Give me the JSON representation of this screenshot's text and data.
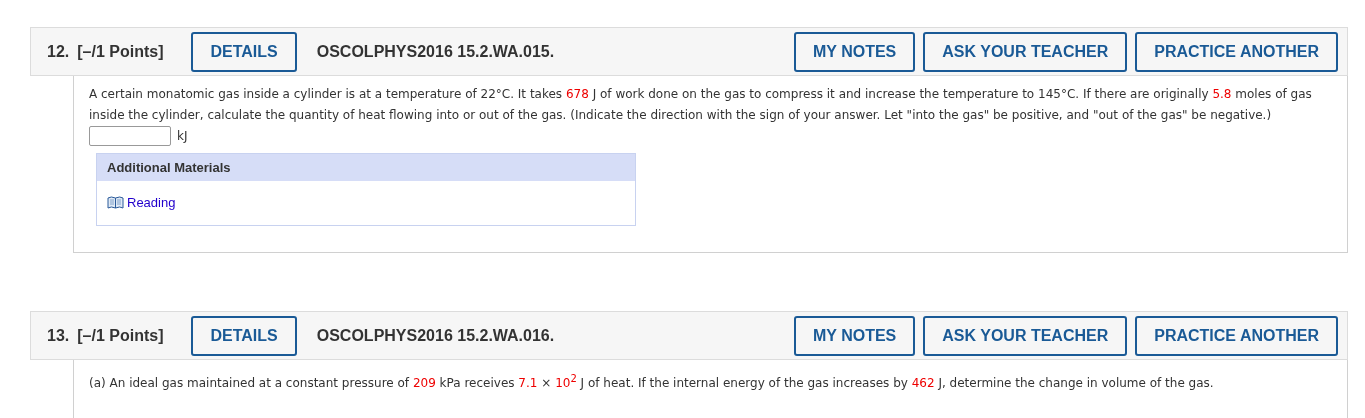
{
  "questions": [
    {
      "number": "12.",
      "points": "[–/1 Points]",
      "code": "OSCOLPHYS2016 15.2.WA.015.",
      "buttons": [
        "DETAILS",
        "MY NOTES",
        "ASK YOUR TEACHER",
        "PRACTICE ANOTHER"
      ],
      "text": [
        {
          "kind": "plain",
          "text": "A certain monatomic gas inside a cylinder is at a temperature of 22°C. It takes "
        },
        {
          "kind": "value",
          "text": "678"
        },
        {
          "kind": "plain",
          "text": " J of work done on the gas to compress it and increase the temperature to 145°C. If there are originally "
        },
        {
          "kind": "value",
          "text": "5.8"
        },
        {
          "kind": "plain",
          "text": " moles of gas inside the cylinder, calculate the quantity of heat flowing into or out of the gas. (Indicate the direction with the sign of your answer. Let \"into the gas\" be positive, and \"out of the gas\" be negative.)"
        }
      ],
      "answer": {
        "unit": "kJ"
      },
      "materials": {
        "title": "Additional Materials",
        "links": [
          "Reading"
        ]
      }
    },
    {
      "number": "13.",
      "points": "[–/1 Points]",
      "code": "OSCOLPHYS2016 15.2.WA.016.",
      "buttons": [
        "DETAILS",
        "MY NOTES",
        "ASK YOUR TEACHER",
        "PRACTICE ANOTHER"
      ],
      "text": [
        {
          "kind": "plain",
          "text": "(a) An ideal gas maintained at a constant pressure of "
        },
        {
          "kind": "value",
          "text": "209"
        },
        {
          "kind": "plain",
          "text": " kPa receives "
        },
        {
          "kind": "value",
          "text": "7.1"
        },
        {
          "kind": "plain",
          "text": " × "
        },
        {
          "kind": "value",
          "text": "10$^{2}$"
        },
        {
          "kind": "plain",
          "text": " J of heat. If the internal energy of the gas increases by "
        },
        {
          "kind": "value",
          "text": "462"
        },
        {
          "kind": "plain",
          "text": " J, determine the change in volume of the gas."
        }
      ]
    }
  ]
}
